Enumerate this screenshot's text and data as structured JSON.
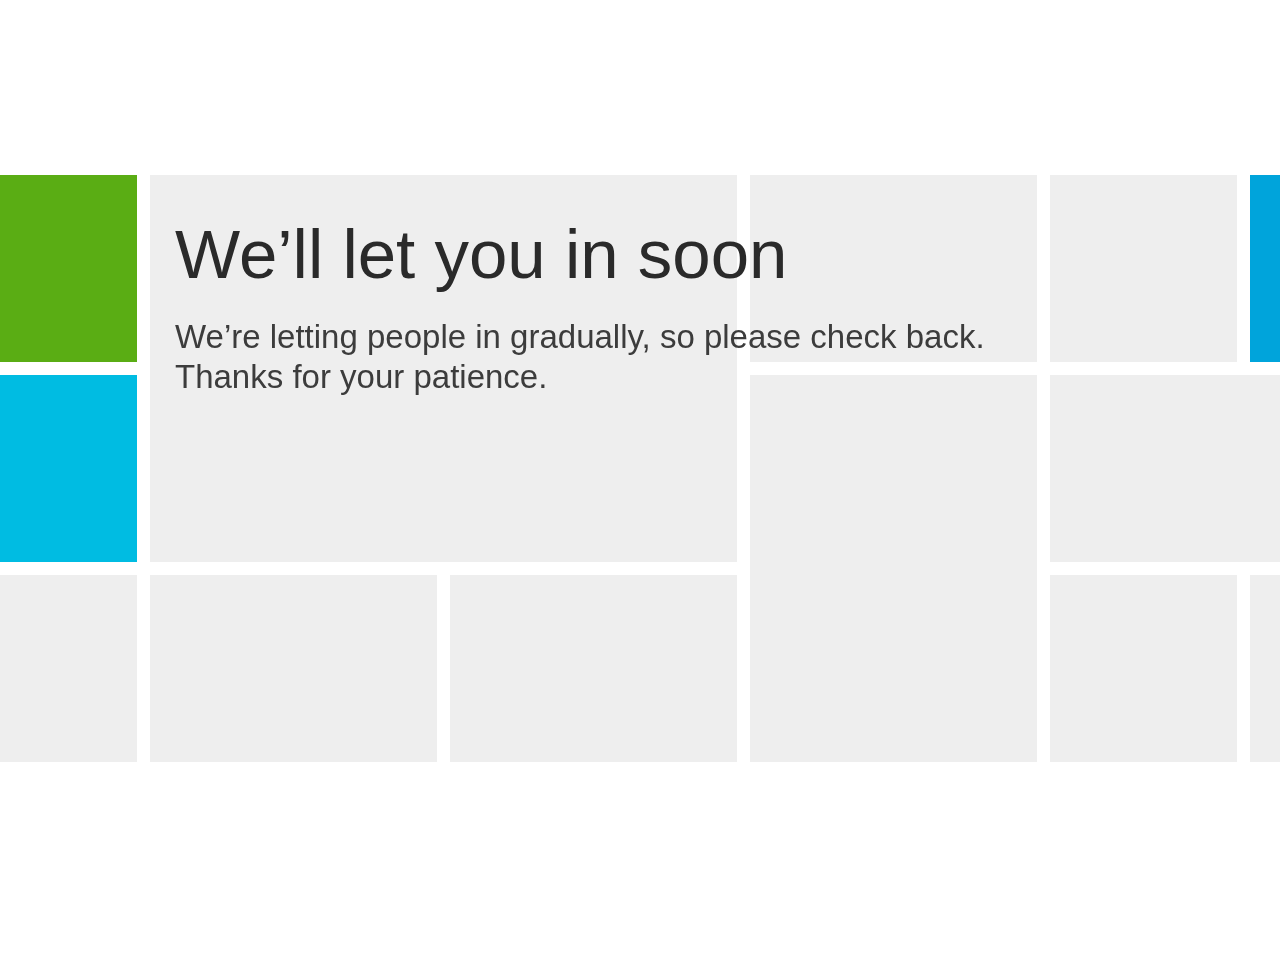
{
  "heading": "We’ll let you in soon",
  "message_lines": [
    "We’re letting people in gradually, so please check back.",
    "Thanks for your patience."
  ]
}
